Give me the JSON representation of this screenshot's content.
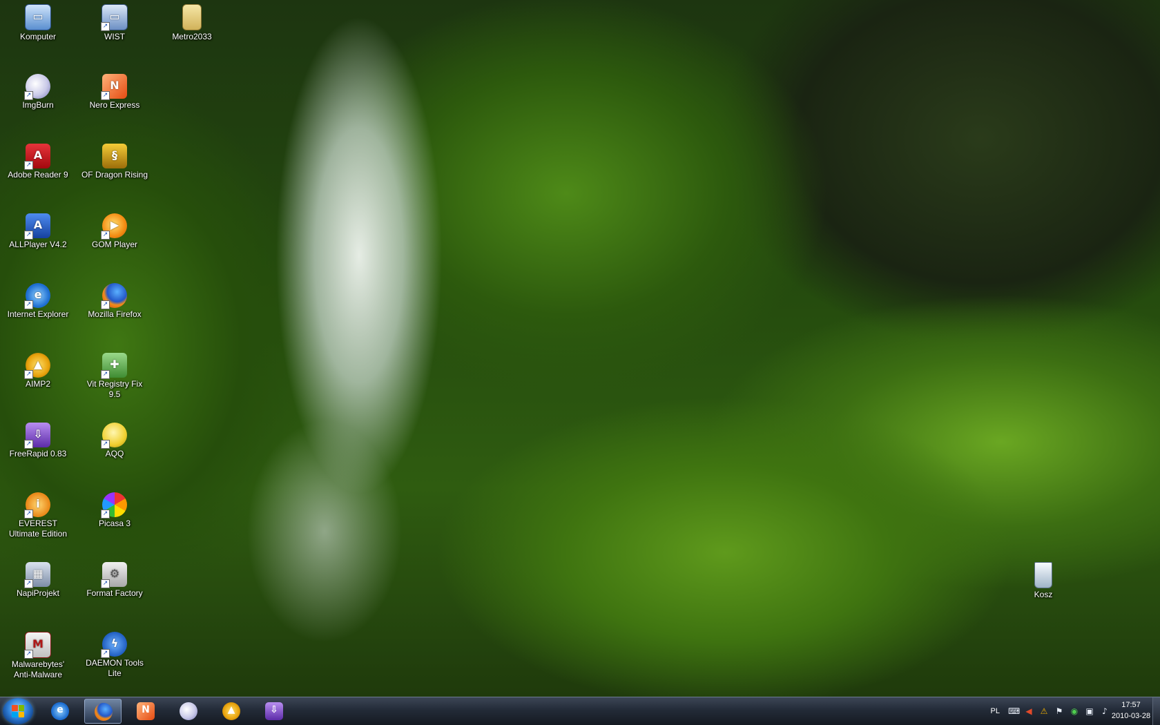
{
  "desktop": {
    "icons": [
      {
        "label": "Komputer",
        "icon": "computer-icon"
      },
      {
        "label": "WIST",
        "icon": "network-computer-icon"
      },
      {
        "label": "Metro2033",
        "icon": "folder-icon"
      },
      {
        "label": "ImgBurn",
        "icon": "disc-burner-icon"
      },
      {
        "label": "Nero Express",
        "icon": "nero-icon"
      },
      {
        "label": "Adobe Reader 9",
        "icon": "pdf-icon"
      },
      {
        "label": "OF Dragon Rising",
        "icon": "dragon-icon"
      },
      {
        "label": "ALLPlayer V4.2",
        "icon": "allplayer-icon"
      },
      {
        "label": "GOM Player",
        "icon": "gom-icon"
      },
      {
        "label": "Internet Explorer",
        "icon": "ie-icon"
      },
      {
        "label": "Mozilla Firefox",
        "icon": "firefox-icon"
      },
      {
        "label": "AIMP2",
        "icon": "aimp-icon"
      },
      {
        "label": "Vit Registry Fix 9.5",
        "icon": "registry-icon"
      },
      {
        "label": "FreeRapid 0.83",
        "icon": "download-icon"
      },
      {
        "label": "AQQ",
        "icon": "lightbulb-icon"
      },
      {
        "label": "EVEREST Ultimate Edition",
        "icon": "everest-icon"
      },
      {
        "label": "Picasa 3",
        "icon": "picasa-icon"
      },
      {
        "label": "NapiProjekt",
        "icon": "clapperboard-icon"
      },
      {
        "label": "Format Factory",
        "icon": "format-factory-icon"
      },
      {
        "label": "Malwarebytes' Anti-Malware",
        "icon": "malwarebytes-icon"
      },
      {
        "label": "DAEMON Tools Lite",
        "icon": "daemon-tools-icon"
      },
      {
        "label": "Kosz",
        "icon": "recycle-bin-icon"
      }
    ]
  },
  "taskbar": {
    "start_icon": "windows-logo-icon",
    "pinned": [
      {
        "icon": "ie-icon",
        "active": false
      },
      {
        "icon": "firefox-icon",
        "active": true
      },
      {
        "icon": "nero-icon",
        "active": false
      },
      {
        "icon": "imgburn-icon",
        "active": false
      },
      {
        "icon": "aimp-icon",
        "active": false
      },
      {
        "icon": "freerapid-icon",
        "active": false
      }
    ],
    "tray": {
      "language": "PL",
      "icons": [
        "keyboard-icon",
        "speaker-alert-icon",
        "update-icon",
        "flag-icon",
        "antivirus-icon",
        "network-icon",
        "volume-icon"
      ]
    },
    "clock": {
      "time": "17:57",
      "date": "2010-03-28"
    }
  },
  "colors": {
    "taskbar_top": "#3c4656",
    "taskbar_bottom": "#151a22",
    "label_text": "#ffffff"
  }
}
